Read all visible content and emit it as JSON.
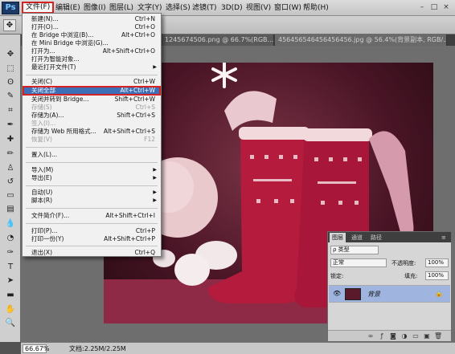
{
  "app": {
    "logo": "Ps"
  },
  "menubar": [
    {
      "label": "文件(F)",
      "active": true
    },
    {
      "label": "编辑(E)"
    },
    {
      "label": "图像(I)"
    },
    {
      "label": "图层(L)"
    },
    {
      "label": "文字(Y)"
    },
    {
      "label": "选择(S)"
    },
    {
      "label": "滤镜(T)"
    },
    {
      "label": "3D(D)"
    },
    {
      "label": "视图(V)"
    },
    {
      "label": "窗口(W)"
    },
    {
      "label": "帮助(H)"
    }
  ],
  "window_controls": {
    "minimize": "–",
    "maximize": "□",
    "close": "×"
  },
  "tabs": [
    {
      "label": "1245674506.png @ 66.7%(RGB...",
      "close": "×"
    },
    {
      "label": "456456546456456456.jpg @ 56.4%(背景副本, RGB/...",
      "close": "×"
    }
  ],
  "file_menu": [
    {
      "label": "新建(N)...",
      "shortcut": "Ctrl+N"
    },
    {
      "label": "打开(O)...",
      "shortcut": "Ctrl+O"
    },
    {
      "label": "在 Bridge 中浏览(B)...",
      "shortcut": "Alt+Ctrl+O"
    },
    {
      "label": "在 Mini Bridge 中浏览(G)..."
    },
    {
      "label": "打开为...",
      "shortcut": "Alt+Shift+Ctrl+O"
    },
    {
      "label": "打开为智能对象..."
    },
    {
      "label": "最近打开文件(T)",
      "submenu": true
    },
    {
      "separator": true
    },
    {
      "label": "关闭(C)",
      "shortcut": "Ctrl+W"
    },
    {
      "label": "关闭全部",
      "shortcut": "Alt+Ctrl+W",
      "highlighted": true
    },
    {
      "label": "关闭并转到 Bridge...",
      "shortcut": "Shift+Ctrl+W"
    },
    {
      "label": "存储(S)",
      "shortcut": "Ctrl+S",
      "disabled": true
    },
    {
      "label": "存储为(A)...",
      "shortcut": "Shift+Ctrl+S"
    },
    {
      "label": "签入(I)...",
      "disabled": true
    },
    {
      "label": "存储为 Web 所用格式...",
      "shortcut": "Alt+Shift+Ctrl+S"
    },
    {
      "label": "恢复(V)",
      "shortcut": "F12",
      "disabled": true
    },
    {
      "separator": true
    },
    {
      "label": "置入(L)..."
    },
    {
      "separator": true
    },
    {
      "label": "导入(M)",
      "submenu": true
    },
    {
      "label": "导出(E)",
      "submenu": true
    },
    {
      "separator": true
    },
    {
      "label": "自动(U)",
      "submenu": true
    },
    {
      "label": "脚本(R)",
      "submenu": true
    },
    {
      "separator": true
    },
    {
      "label": "文件简介(F)...",
      "shortcut": "Alt+Shift+Ctrl+I"
    },
    {
      "separator": true
    },
    {
      "label": "打印(P)...",
      "shortcut": "Ctrl+P"
    },
    {
      "label": "打印一份(Y)",
      "shortcut": "Alt+Shift+Ctrl+P"
    },
    {
      "separator": true
    },
    {
      "label": "退出(X)",
      "shortcut": "Ctrl+Q"
    }
  ],
  "layers_panel": {
    "tabs": [
      "图层",
      "通道",
      "路径"
    ],
    "filter_kind": "ρ 类型",
    "blend_mode": "正常",
    "opacity_label": "不透明度:",
    "opacity_value": "100%",
    "lock_label": "锁定:",
    "fill_label": "填充:",
    "fill_value": "100%",
    "layer_name": "背景"
  },
  "status": {
    "zoom": "66.67%",
    "doc_info": "文档:2.25M/2.25M"
  }
}
